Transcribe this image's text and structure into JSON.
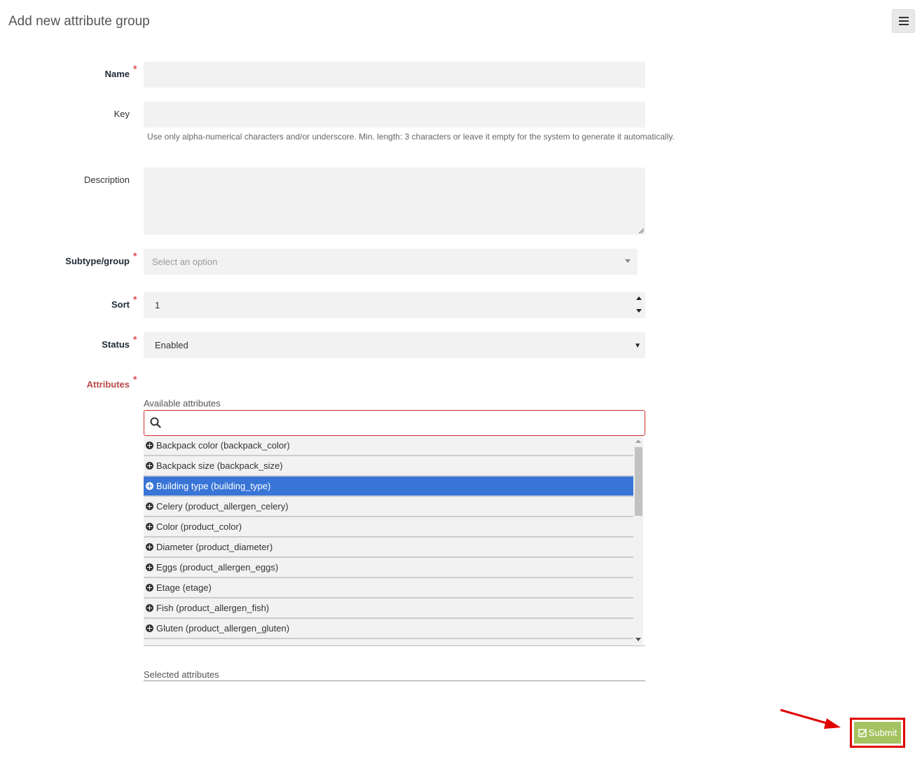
{
  "page": {
    "title": "Add new attribute group"
  },
  "header": {
    "menu_icon": "hamburger-menu-icon"
  },
  "form": {
    "name": {
      "label": "Name",
      "required": true,
      "value": ""
    },
    "key": {
      "label": "Key",
      "value": "",
      "help": "Use only alpha-numerical characters and/or underscore. Min. length: 3 characters or leave it empty for the system to generate it automatically."
    },
    "description": {
      "label": "Description",
      "value": ""
    },
    "subtype": {
      "label": "Subtype/group",
      "required": true,
      "placeholder": "Select an option"
    },
    "sort": {
      "label": "Sort",
      "required": true,
      "value": "1"
    },
    "status": {
      "label": "Status",
      "required": true,
      "value": "Enabled"
    },
    "attributes": {
      "label": "Attributes",
      "required": true,
      "available_label": "Available attributes",
      "search_value": "",
      "available": [
        "Backpack color (backpack_color)",
        "Backpack size (backpack_size)",
        "Building type (building_type)",
        "Celery (product_allergen_celery)",
        "Color (product_color)",
        "Diameter (product_diameter)",
        "Eggs (product_allergen_eggs)",
        "Etage (etage)",
        "Fish (product_allergen_fish)",
        "Gluten (product_allergen_gluten)"
      ],
      "highlighted": "Building type (building_type)",
      "selected_label": "Selected attributes"
    }
  },
  "actions": {
    "submit_label": "Submit"
  },
  "colors": {
    "highlight": "#3875d7",
    "submit": "#a5c261",
    "annotation": "#e00000",
    "required": "#d9534f"
  }
}
